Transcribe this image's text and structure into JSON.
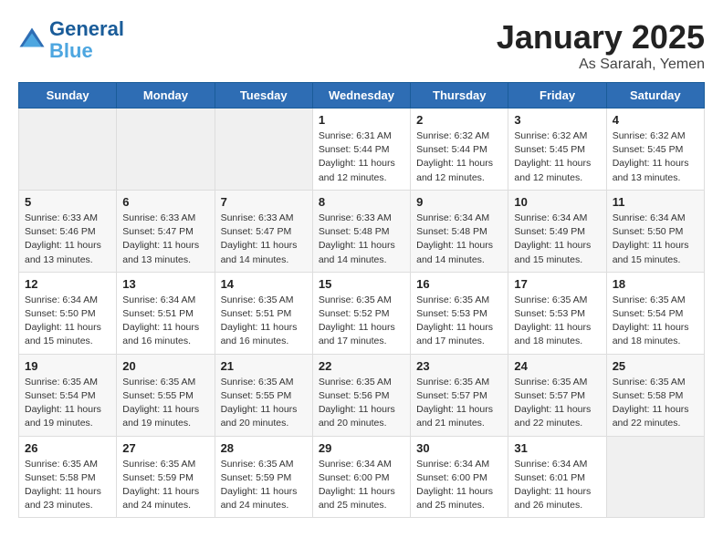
{
  "header": {
    "logo_line1": "General",
    "logo_line2": "Blue",
    "month": "January 2025",
    "location": "As Sararah, Yemen"
  },
  "weekdays": [
    "Sunday",
    "Monday",
    "Tuesday",
    "Wednesday",
    "Thursday",
    "Friday",
    "Saturday"
  ],
  "weeks": [
    [
      {
        "day": "",
        "info": ""
      },
      {
        "day": "",
        "info": ""
      },
      {
        "day": "",
        "info": ""
      },
      {
        "day": "1",
        "info": "Sunrise: 6:31 AM\nSunset: 5:44 PM\nDaylight: 11 hours\nand 12 minutes."
      },
      {
        "day": "2",
        "info": "Sunrise: 6:32 AM\nSunset: 5:44 PM\nDaylight: 11 hours\nand 12 minutes."
      },
      {
        "day": "3",
        "info": "Sunrise: 6:32 AM\nSunset: 5:45 PM\nDaylight: 11 hours\nand 12 minutes."
      },
      {
        "day": "4",
        "info": "Sunrise: 6:32 AM\nSunset: 5:45 PM\nDaylight: 11 hours\nand 13 minutes."
      }
    ],
    [
      {
        "day": "5",
        "info": "Sunrise: 6:33 AM\nSunset: 5:46 PM\nDaylight: 11 hours\nand 13 minutes."
      },
      {
        "day": "6",
        "info": "Sunrise: 6:33 AM\nSunset: 5:47 PM\nDaylight: 11 hours\nand 13 minutes."
      },
      {
        "day": "7",
        "info": "Sunrise: 6:33 AM\nSunset: 5:47 PM\nDaylight: 11 hours\nand 14 minutes."
      },
      {
        "day": "8",
        "info": "Sunrise: 6:33 AM\nSunset: 5:48 PM\nDaylight: 11 hours\nand 14 minutes."
      },
      {
        "day": "9",
        "info": "Sunrise: 6:34 AM\nSunset: 5:48 PM\nDaylight: 11 hours\nand 14 minutes."
      },
      {
        "day": "10",
        "info": "Sunrise: 6:34 AM\nSunset: 5:49 PM\nDaylight: 11 hours\nand 15 minutes."
      },
      {
        "day": "11",
        "info": "Sunrise: 6:34 AM\nSunset: 5:50 PM\nDaylight: 11 hours\nand 15 minutes."
      }
    ],
    [
      {
        "day": "12",
        "info": "Sunrise: 6:34 AM\nSunset: 5:50 PM\nDaylight: 11 hours\nand 15 minutes."
      },
      {
        "day": "13",
        "info": "Sunrise: 6:34 AM\nSunset: 5:51 PM\nDaylight: 11 hours\nand 16 minutes."
      },
      {
        "day": "14",
        "info": "Sunrise: 6:35 AM\nSunset: 5:51 PM\nDaylight: 11 hours\nand 16 minutes."
      },
      {
        "day": "15",
        "info": "Sunrise: 6:35 AM\nSunset: 5:52 PM\nDaylight: 11 hours\nand 17 minutes."
      },
      {
        "day": "16",
        "info": "Sunrise: 6:35 AM\nSunset: 5:53 PM\nDaylight: 11 hours\nand 17 minutes."
      },
      {
        "day": "17",
        "info": "Sunrise: 6:35 AM\nSunset: 5:53 PM\nDaylight: 11 hours\nand 18 minutes."
      },
      {
        "day": "18",
        "info": "Sunrise: 6:35 AM\nSunset: 5:54 PM\nDaylight: 11 hours\nand 18 minutes."
      }
    ],
    [
      {
        "day": "19",
        "info": "Sunrise: 6:35 AM\nSunset: 5:54 PM\nDaylight: 11 hours\nand 19 minutes."
      },
      {
        "day": "20",
        "info": "Sunrise: 6:35 AM\nSunset: 5:55 PM\nDaylight: 11 hours\nand 19 minutes."
      },
      {
        "day": "21",
        "info": "Sunrise: 6:35 AM\nSunset: 5:55 PM\nDaylight: 11 hours\nand 20 minutes."
      },
      {
        "day": "22",
        "info": "Sunrise: 6:35 AM\nSunset: 5:56 PM\nDaylight: 11 hours\nand 20 minutes."
      },
      {
        "day": "23",
        "info": "Sunrise: 6:35 AM\nSunset: 5:57 PM\nDaylight: 11 hours\nand 21 minutes."
      },
      {
        "day": "24",
        "info": "Sunrise: 6:35 AM\nSunset: 5:57 PM\nDaylight: 11 hours\nand 22 minutes."
      },
      {
        "day": "25",
        "info": "Sunrise: 6:35 AM\nSunset: 5:58 PM\nDaylight: 11 hours\nand 22 minutes."
      }
    ],
    [
      {
        "day": "26",
        "info": "Sunrise: 6:35 AM\nSunset: 5:58 PM\nDaylight: 11 hours\nand 23 minutes."
      },
      {
        "day": "27",
        "info": "Sunrise: 6:35 AM\nSunset: 5:59 PM\nDaylight: 11 hours\nand 24 minutes."
      },
      {
        "day": "28",
        "info": "Sunrise: 6:35 AM\nSunset: 5:59 PM\nDaylight: 11 hours\nand 24 minutes."
      },
      {
        "day": "29",
        "info": "Sunrise: 6:34 AM\nSunset: 6:00 PM\nDaylight: 11 hours\nand 25 minutes."
      },
      {
        "day": "30",
        "info": "Sunrise: 6:34 AM\nSunset: 6:00 PM\nDaylight: 11 hours\nand 25 minutes."
      },
      {
        "day": "31",
        "info": "Sunrise: 6:34 AM\nSunset: 6:01 PM\nDaylight: 11 hours\nand 26 minutes."
      },
      {
        "day": "",
        "info": ""
      }
    ]
  ]
}
